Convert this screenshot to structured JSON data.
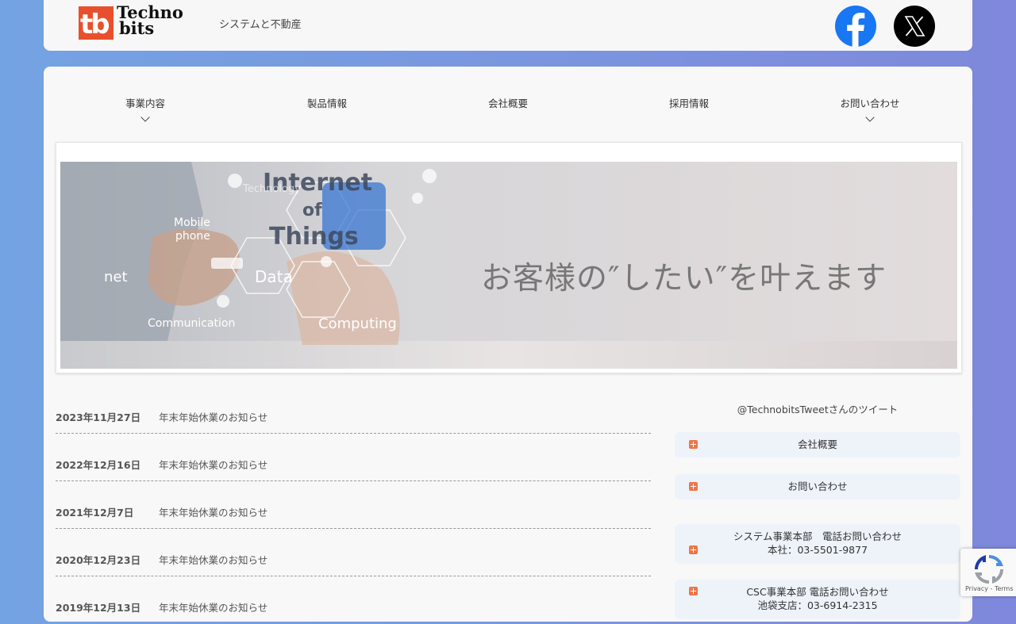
{
  "header": {
    "logo_mark": "tb",
    "logo_line1": "Techno",
    "logo_line2": "bits",
    "tagline": "システムと不動産",
    "social": [
      {
        "name": "facebook-icon",
        "color": "#1877f2"
      },
      {
        "name": "x-icon",
        "color": "#000000"
      }
    ]
  },
  "nav": {
    "items": [
      {
        "label": "事業内容",
        "has_dropdown": true
      },
      {
        "label": "製品情報",
        "has_dropdown": false
      },
      {
        "label": "会社概要",
        "has_dropdown": false
      },
      {
        "label": "採用情報",
        "has_dropdown": false
      },
      {
        "label": "お問い合わせ",
        "has_dropdown": true
      }
    ]
  },
  "hero": {
    "headline": "お客様の″したい″を叶えます",
    "image_words": [
      "Internet",
      "of",
      "Things",
      "Mobile",
      "phone",
      "net",
      "Data",
      "Communication",
      "Computing",
      "Technology"
    ]
  },
  "news": [
    {
      "date": "2023年11月27日",
      "title": "年末年始休業のお知らせ"
    },
    {
      "date": "2022年12月16日",
      "title": "年末年始休業のお知らせ"
    },
    {
      "date": "2021年12月7日",
      "title": "年末年始休業のお知らせ"
    },
    {
      "date": "2020年12月23日",
      "title": "年末年始休業のお知らせ"
    },
    {
      "date": "2019年12月13日",
      "title": "年末年始休業のお知らせ"
    }
  ],
  "sidebar": {
    "twitter_label": "@TechnobitsTweetさんのツイート",
    "links": [
      {
        "lines": [
          "会社概要"
        ]
      },
      {
        "lines": [
          "お問い合わせ"
        ]
      },
      {
        "lines": [
          "システム事業本部　電話お問い合わせ",
          "本社：03-5501-9877"
        ]
      },
      {
        "lines": [
          "CSC事業本部 電話お問い合わせ",
          "池袋支店：03-6914-2315"
        ]
      }
    ]
  },
  "recaptcha": {
    "label": "Privacy - Terms"
  },
  "colors": {
    "accent": "#ee7448",
    "background": "#7b95de",
    "panel": "#f8f8f8"
  }
}
